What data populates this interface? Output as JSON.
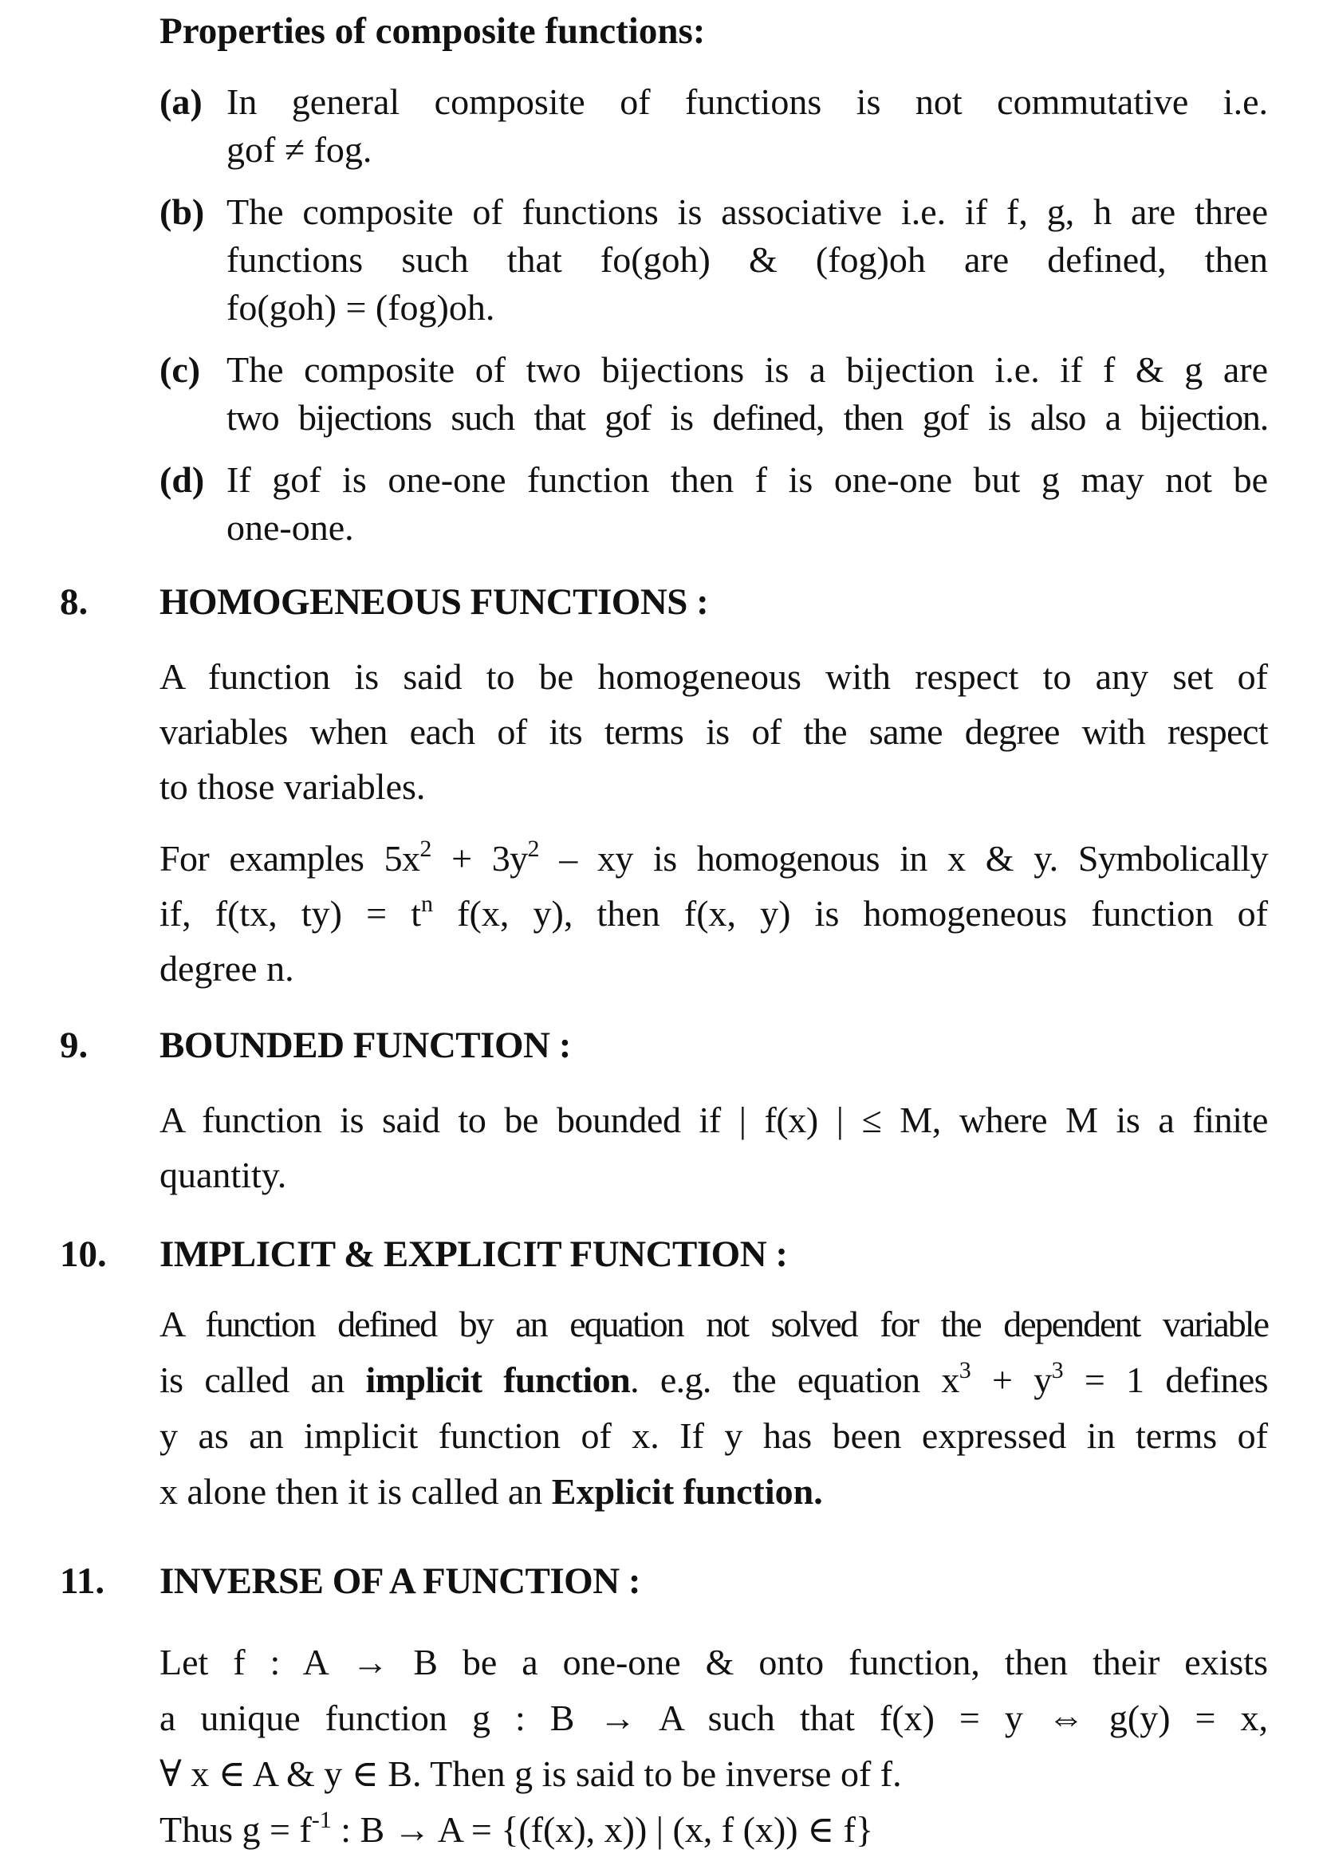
{
  "properties": {
    "title": "Properties of composite functions:",
    "items": [
      {
        "label": "(a)",
        "lines": [
          "In general composite of functions is not commutative i.e.",
          "gof ≠ fog."
        ]
      },
      {
        "label": "(b)",
        "lines": [
          "The composite of functions is associative i.e. if f, g, h are three",
          "functions such that fo(goh) & (fog)oh are defined, then",
          "fo(goh) = (fog)oh."
        ]
      },
      {
        "label": "(c)",
        "lines": [
          "The composite of two bijections is a bijection i.e. if f & g are",
          "two bijections such that gof is defined, then gof is also a bijection."
        ]
      },
      {
        "label": "(d)",
        "lines": [
          "If gof is one-one function then f is one-one but g may not be",
          "one-one."
        ]
      }
    ]
  },
  "sections": [
    {
      "number": "8.",
      "heading": "HOMOGENEOUS FUNCTIONS :",
      "p1": [
        "A function is said to be homogeneous with respect to any set of",
        "variables when each of its terms is of the same degree with respect",
        "to those variables."
      ],
      "p2": {
        "l1_a": "For examples 5x",
        "l1_sup1": "2",
        "l1_b": " + 3y",
        "l1_sup2": "2",
        "l1_c": " – xy is homogenous in x & y. Symbolically",
        "l2_a": "if, f(tx, ty) = t",
        "l2_sup": "n",
        "l2_b": " f(x, y), then f(x, y) is homogeneous function of",
        "l3": "degree n."
      }
    },
    {
      "number": "9.",
      "heading": "BOUNDED FUNCTION :",
      "p1": [
        "A function is said to be bounded if | f(x) | ≤ M, where M is a finite",
        "quantity."
      ]
    },
    {
      "number": "10.",
      "heading": "IMPLICIT & EXPLICIT FUNCTION :",
      "l1": "A function defined by an equation not solved for the dependent variable",
      "l2_a": "is called an ",
      "l2_bold": "implicit function",
      "l2_b": ". e.g. the equation x",
      "l2_sup1": "3",
      "l2_c": " + y",
      "l2_sup2": "3",
      "l2_d": " = 1 defines",
      "l3": "y as an implicit function of x. If y has been expressed in terms of",
      "l4_a": "x alone then it is called an ",
      "l4_bold": "Explicit function."
    },
    {
      "number": "11.",
      "heading": "INVERSE OF A FUNCTION :",
      "l1": "Let f : A → B be a one-one & onto function, then their exists",
      "l2": "a unique function g : B → A such that f(x) = y ⇔ g(y) = x,",
      "l3": "∀ x ∈ A & y ∈ B. Then g is said to be inverse of f.",
      "l4_a": "Thus g = f",
      "l4_sup": "-1",
      "l4_b": " : B → A = {(f(x), x)) | (x, f (x)) ∈ f}"
    }
  ]
}
